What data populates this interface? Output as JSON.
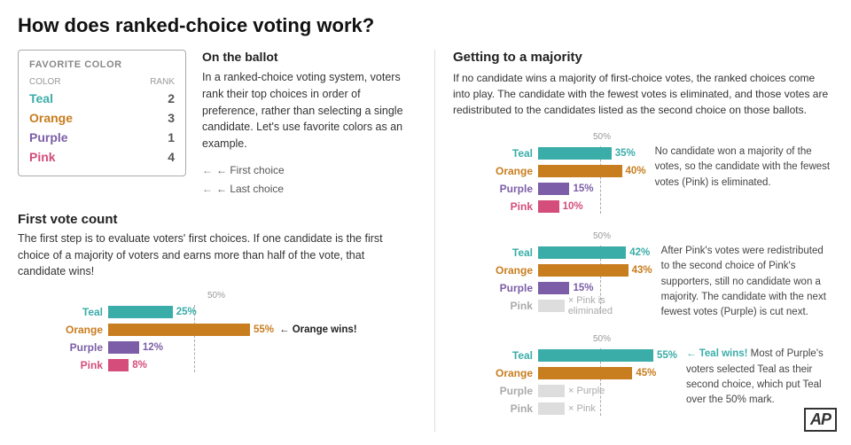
{
  "page": {
    "title": "How does ranked-choice voting work?"
  },
  "favColor": {
    "boxTitle": "FAVORITE COLOR",
    "colColor": "COLOR",
    "colRank": "RANK",
    "rows": [
      {
        "color": "Teal",
        "rank": "2",
        "cls": "color-teal"
      },
      {
        "color": "Orange",
        "rank": "3",
        "cls": "color-orange"
      },
      {
        "color": "Purple",
        "rank": "1",
        "cls": "color-purple"
      },
      {
        "color": "Pink",
        "rank": "4",
        "cls": "color-pink"
      }
    ]
  },
  "ballot": {
    "heading": "On the ballot",
    "text": "In a ranked-choice voting system, voters rank their top choices in order of preference, rather than selecting a single candidate. Let's use favorite colors as an example.",
    "firstChoice": "← First choice",
    "lastChoice": "← Last choice"
  },
  "firstVote": {
    "heading": "First vote count",
    "desc": "The first step is to evaluate voters' first choices. If one candidate is the first choice of a majority of voters and earns more than half of the vote, that candidate wins!",
    "fiftyLabel": "50%",
    "bars": [
      {
        "label": "Teal",
        "pct": 25,
        "cls": "color-teal",
        "barColor": "#3aada8",
        "pctText": "25%",
        "note": "",
        "eliminated": false
      },
      {
        "label": "Orange",
        "pct": 55,
        "cls": "color-orange",
        "barColor": "#c87d1e",
        "pctText": "55%",
        "note": "← Orange wins!",
        "eliminated": false
      },
      {
        "label": "Purple",
        "pct": 12,
        "cls": "color-purple",
        "barColor": "#7b5ea7",
        "pctText": "12%",
        "note": "",
        "eliminated": false
      },
      {
        "label": "Pink",
        "pct": 8,
        "cls": "color-pink",
        "barColor": "#d44d7b",
        "pctText": "8%",
        "note": "",
        "eliminated": false
      }
    ],
    "barMaxWidth": 160
  },
  "majority": {
    "heading": "Getting to a majority",
    "intro": "If no candidate wins a majority of first-choice votes, the ranked choices come into play. The candidate with the fewest votes is eliminated, and those votes are redistributed to the candidates listed as the second choice on those ballots.",
    "fiftyLabel": "50%",
    "rounds": [
      {
        "bars": [
          {
            "label": "Teal",
            "pct": 35,
            "pctText": "35%",
            "barColor": "#3aada8",
            "eliminated": false
          },
          {
            "label": "Orange",
            "pct": 40,
            "pctText": "40%",
            "barColor": "#c87d1e",
            "eliminated": false
          },
          {
            "label": "Purple",
            "pct": 15,
            "pctText": "15%",
            "barColor": "#7b5ea7",
            "eliminated": false
          },
          {
            "label": "Pink",
            "pct": 10,
            "pctText": "10%",
            "barColor": "#d44d7b",
            "eliminated": false
          }
        ],
        "note": "No candidate won a majority of the votes, so the candidate with the fewest votes (Pink) is eliminated.",
        "noteWins": ""
      },
      {
        "bars": [
          {
            "label": "Teal",
            "pct": 42,
            "pctText": "42%",
            "barColor": "#3aada8",
            "eliminated": false
          },
          {
            "label": "Orange",
            "pct": 43,
            "pctText": "43%",
            "barColor": "#c87d1e",
            "eliminated": false
          },
          {
            "label": "Purple",
            "pct": 15,
            "pctText": "15%",
            "barColor": "#7b5ea7",
            "eliminated": false
          },
          {
            "label": "Pink",
            "pct": 0,
            "pctText": "× Pink is eliminated",
            "barColor": "#ccc",
            "eliminated": true
          }
        ],
        "note": "After Pink's votes were redistributed to the second choice of Pink's supporters, still no candidate won a majority. The candidate with the next fewest votes (Purple) is cut next.",
        "noteWins": ""
      },
      {
        "bars": [
          {
            "label": "Teal",
            "pct": 55,
            "pctText": "55%",
            "barColor": "#3aada8",
            "eliminated": false
          },
          {
            "label": "Orange",
            "pct": 45,
            "pctText": "45%",
            "barColor": "#c87d1e",
            "eliminated": false
          },
          {
            "label": "Purple",
            "pct": 0,
            "pctText": "× Purple",
            "barColor": "#ccc",
            "eliminated": true
          },
          {
            "label": "Pink",
            "pct": 0,
            "pctText": "× Pink",
            "barColor": "#ccc",
            "eliminated": true
          }
        ],
        "note": "Most of Purple's voters selected Teal as their second choice, which put Teal over the 50% mark.",
        "noteWins": "← Teal wins!"
      }
    ],
    "barMaxWidth": 130
  },
  "ap": "AP"
}
